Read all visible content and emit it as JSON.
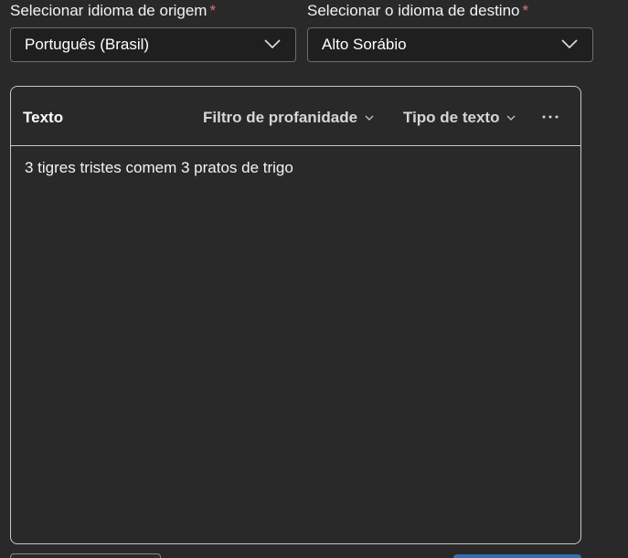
{
  "source_language": {
    "label": "Selecionar idioma de origem",
    "required_mark": "*",
    "selected": "Português (Brasil)"
  },
  "target_language": {
    "label": "Selecionar o idioma de destino",
    "required_mark": "*",
    "selected": "Alto Sorábio"
  },
  "panel": {
    "title": "Texto",
    "profanity_filter_label": "Filtro de profanidade",
    "text_type_label": "Tipo de texto",
    "more_label": "···",
    "input_text": "3 tigres tristes comem 3 pratos de trigo"
  },
  "icons": {
    "dropdown": "chevron-down-icon",
    "more": "more-horizontal-icon"
  },
  "colors": {
    "background": "#292929",
    "field_background": "#1f1f1f",
    "required": "#e57373",
    "primary_button": "#2f6fb6"
  }
}
